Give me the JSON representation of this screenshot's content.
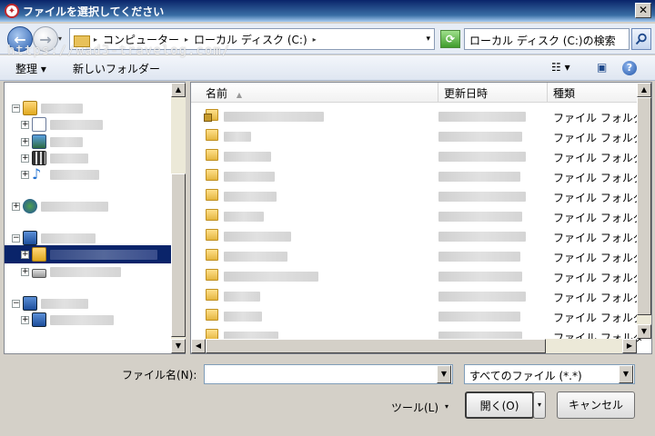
{
  "window": {
    "title": "ファイルを選択してください",
    "close_glyph": "✕"
  },
  "nav": {
    "back_glyph": "←",
    "forward_glyph": "→",
    "history_glyph": "▾",
    "breadcrumbs": [
      "コンピューター",
      "ローカル ディスク (C:)"
    ],
    "sep_glyph": "▸",
    "dd_glyph": "▾",
    "refresh_glyph": "⟳",
    "search_placeholder": "ローカル ディスク (C:)の検索"
  },
  "toolbar": {
    "organize_label": "整理 ▾",
    "new_folder_label": "新しいフォルダー",
    "view_glyph": "☷ ▾",
    "preview_glyph": "▣",
    "help_glyph": "?"
  },
  "watermark": "https://wad3-travelog.com/",
  "file_list": {
    "columns": {
      "name": "名前",
      "name_sort_glyph": "▲",
      "date": "更新日時",
      "type": "種類"
    },
    "rows": [
      {
        "type": "ファイル フォルダー"
      },
      {
        "type": "ファイル フォルダー"
      },
      {
        "type": "ファイル フォルダー"
      },
      {
        "type": "ファイル フォルダー"
      },
      {
        "type": "ファイル フォルダー"
      },
      {
        "type": "ファイル フォルダー"
      },
      {
        "type": "ファイル フォルダー"
      },
      {
        "type": "ファイル フォルダー"
      },
      {
        "type": "ファイル フォルダー"
      },
      {
        "type": "ファイル フォルダー"
      },
      {
        "type": "ファイル フォルダー"
      },
      {
        "type": "ファイル フォルダー"
      }
    ]
  },
  "scroll": {
    "up": "▲",
    "down": "▼",
    "left": "◀",
    "right": "▶"
  },
  "form": {
    "filename_label": "ファイル名(N):",
    "filename_value": "",
    "filetype_value": "すべてのファイル (*.*)",
    "dd_glyph": "▼",
    "tools_label": "ツール(L)",
    "tools_dd": "▾",
    "open_label": "開く(O)",
    "open_dd": "▾",
    "cancel_label": "キャンセル"
  }
}
